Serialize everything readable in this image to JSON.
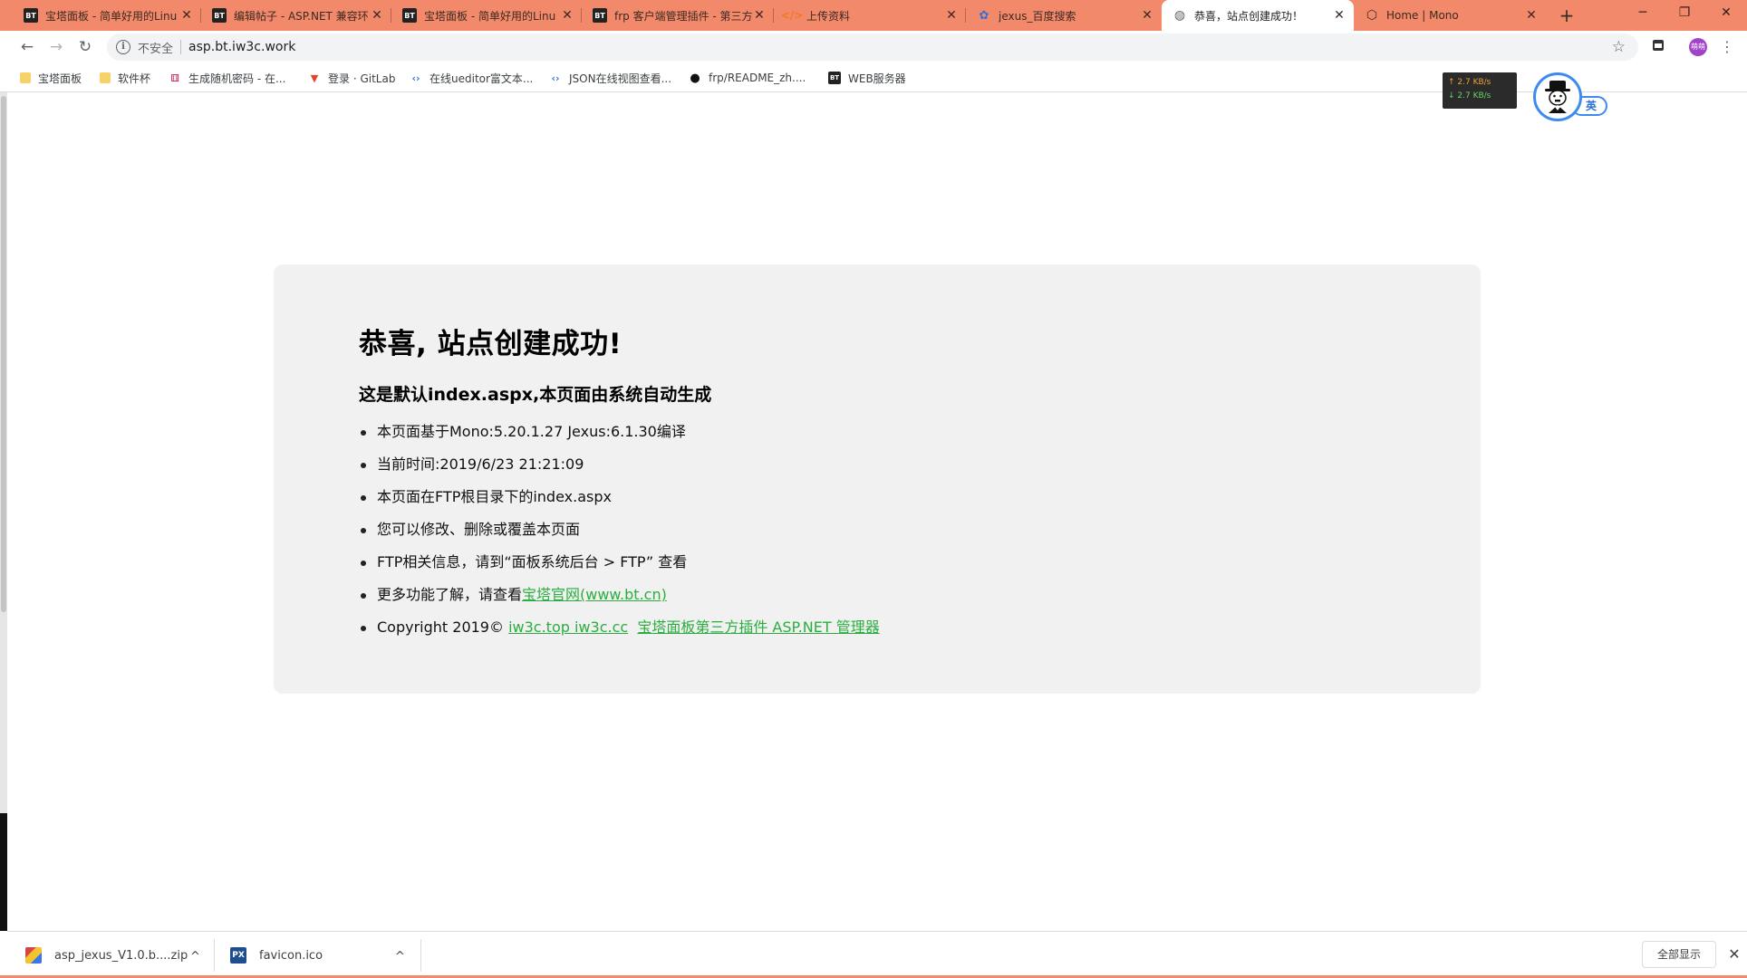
{
  "tabs": [
    {
      "favicon": "bt-icon",
      "title": "宝塔面板 - 简单好用的Linu",
      "close": "✕"
    },
    {
      "favicon": "bt-icon",
      "title": "编辑帖子 - ASP.NET 兼容环",
      "close": "✕"
    },
    {
      "favicon": "bt-icon",
      "title": "宝塔面板 - 简单好用的Linu",
      "close": "✕"
    },
    {
      "favicon": "bt-icon",
      "title": "frp 客户端管理插件 - 第三方",
      "close": "✕"
    },
    {
      "favicon": "code-icon",
      "title": "上传资料",
      "close": "✕"
    },
    {
      "favicon": "baidu-paw-icon",
      "title": "jexus_百度搜索",
      "close": "✕"
    },
    {
      "favicon": "globe-icon",
      "title": "恭喜，站点创建成功！",
      "close": "✕",
      "active": true
    },
    {
      "favicon": "mono-icon",
      "title": "Home | Mono",
      "close": "✕"
    }
  ],
  "tabstrip": {
    "new_tab": "+",
    "minimize": "─",
    "restore": "❐",
    "close": "✕"
  },
  "toolbar": {
    "back": "←",
    "forward": "→",
    "reload": "↻",
    "security_label": "不安全",
    "url": "asp.bt.iw3c.work",
    "star": "☆",
    "profile": "萌萌"
  },
  "bookmarks": [
    {
      "icon": "folder-icon",
      "label": "宝塔面板"
    },
    {
      "icon": "folder-icon",
      "label": "软件杯"
    },
    {
      "icon": "dice-icon",
      "label": "生成随机密码 - 在..."
    },
    {
      "icon": "gitlab-fox-icon",
      "label": "登录 · GitLab"
    },
    {
      "icon": "code-arrows-icon",
      "label": "在线ueditor富文本..."
    },
    {
      "icon": "code-arrows-icon",
      "label": "JSON在线视图查看..."
    },
    {
      "icon": "github-icon",
      "label": "frp/README_zh...."
    },
    {
      "icon": "bt-icon",
      "label": "WEB服务器"
    }
  ],
  "overlay": {
    "upload_speed": "↑ 2.7 KB/s",
    "download_speed": "↓ 2.7 KB/s",
    "ime_label": "英"
  },
  "page": {
    "title": "恭喜, 站点创建成功!",
    "subtitle": "这是默认index.aspx,本页面由系统自动生成",
    "items": [
      "本页面基于Mono:5.20.1.27 Jexus:6.1.30编译",
      "当前时间:2019/6/23 21:21:09",
      "本页面在FTP根目录下的index.aspx",
      "您可以修改、删除或覆盖本页面",
      "FTP相关信息，请到“面板系统后台 > FTP” 查看"
    ],
    "more_prefix": "更多功能了解，请查看",
    "more_link": "宝塔官网(www.bt.cn)",
    "copyright_prefix": "Copyright 2019© ",
    "copyright_link1": "iw3c.top iw3c.cc",
    "copyright_link2": "宝塔面板第三方插件 ASP.NET 管理器"
  },
  "downloads": {
    "items": [
      {
        "icon": "zip-archive-icon",
        "name": "asp_jexus_V1.0.b....zip"
      },
      {
        "icon": "px-file-icon",
        "name": "favicon.ico"
      }
    ],
    "show_all": "全部显示",
    "close": "✕",
    "chevron": "^"
  }
}
